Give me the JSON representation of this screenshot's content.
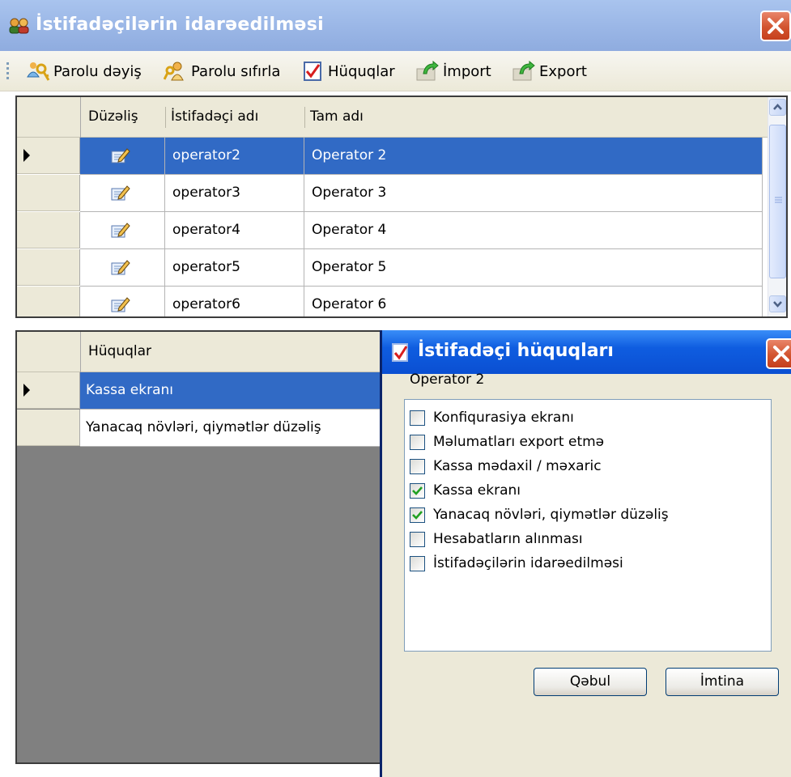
{
  "window": {
    "title": "İstifadəçilərin idarəedilməsi"
  },
  "toolbar": {
    "items": [
      {
        "label": "Parolu dəyiş",
        "icon": "key-person-icon"
      },
      {
        "label": "Parolu sıfırla",
        "icon": "key-reset-icon"
      },
      {
        "label": "Hüquqlar",
        "icon": "checkmark-document-icon"
      },
      {
        "label": "İmport",
        "icon": "import-icon"
      },
      {
        "label": "Export",
        "icon": "export-icon"
      }
    ]
  },
  "users_grid": {
    "columns": [
      "Düzəliş",
      "İstifadəçi adı",
      "Tam adı"
    ],
    "rows": [
      {
        "username": "operator2",
        "fullname": "Operator 2",
        "selected": true
      },
      {
        "username": "operator3",
        "fullname": "Operator 3",
        "selected": false
      },
      {
        "username": "operator4",
        "fullname": "Operator 4",
        "selected": false
      },
      {
        "username": "operator5",
        "fullname": "Operator 5",
        "selected": false
      },
      {
        "username": "operator6",
        "fullname": "Operator 6",
        "selected": false
      }
    ]
  },
  "rights_grid": {
    "column": "Hüquqlar",
    "rows": [
      {
        "label": "Kassa ekranı",
        "selected": true
      },
      {
        "label": "Yanacaq növləri, qiymətlər düzəliş",
        "selected": false
      }
    ]
  },
  "dialog": {
    "title": "İstifadəçi hüquqları",
    "user": "Operator 2",
    "permissions": [
      {
        "label": "Konfiqurasiya ekranı",
        "checked": false
      },
      {
        "label": "Məlumatları export etmə",
        "checked": false
      },
      {
        "label": "Kassa mədaxil / məxaric",
        "checked": false
      },
      {
        "label": "Kassa ekranı",
        "checked": true
      },
      {
        "label": "Yanacaq növləri, qiymətlər düzəliş",
        "checked": true
      },
      {
        "label": "Hesabatların alınması",
        "checked": false
      },
      {
        "label": "İstifadəçilərin idarəedilməsi",
        "checked": false
      }
    ],
    "ok_label": "Qəbul",
    "cancel_label": "İmtina"
  },
  "colors": {
    "selection": "#316ac5",
    "title_bar": "#9ab6e6",
    "dialog_title_bar": "#0f5de0",
    "grid_background": "#808080"
  }
}
